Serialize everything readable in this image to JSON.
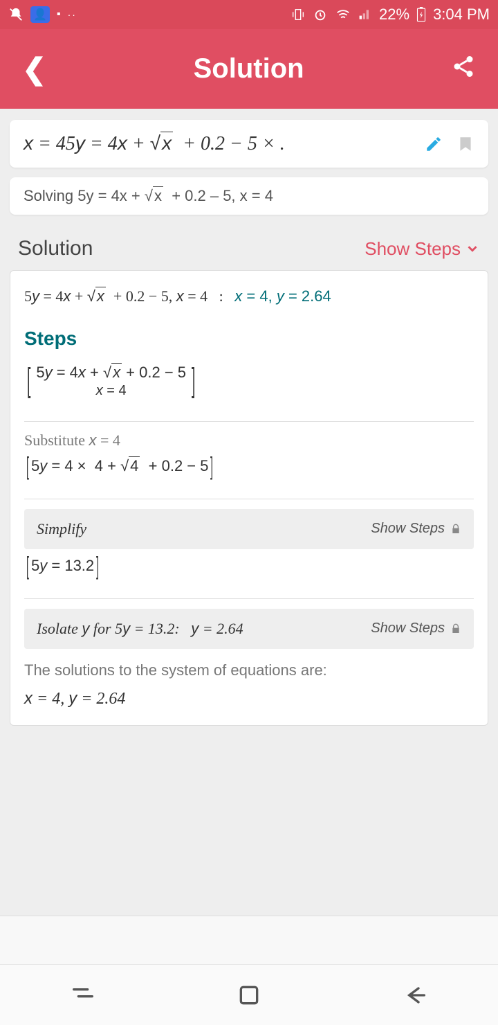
{
  "status": {
    "battery": "22%",
    "time": "3:04 PM"
  },
  "header": {
    "title": "Solution"
  },
  "equation_display": "x = 45y = 4x + √x  + 0.2 − 5 × .",
  "solving_line": "Solving 5y = 4x + √x  + 0.2 – 5, x = 4",
  "section": {
    "title": "Solution",
    "show_steps": "Show Steps"
  },
  "solution": {
    "result_left": "5y = 4x + √x  + 0.2 − 5, x = 4",
    "result_right": "x = 4, y = 2.64",
    "steps_title": "Steps",
    "system_top": "5y = 4x + √x  + 0.2 − 5",
    "system_bottom": "x = 4",
    "substitute_label": "Substitute x = 4",
    "substitute_eq": "5y = 4 ×  4 + √4  + 0.2 − 5",
    "simplify_label": "Simplify",
    "simplify_result": "5y = 13.2",
    "isolate_label": "Isolate y for 5y = 13.2:   y = 2.64",
    "final_text": "The solutions to the system of equations are:",
    "final_answer": "x = 4, y = 2.64",
    "show_steps_locked": "Show Steps"
  }
}
